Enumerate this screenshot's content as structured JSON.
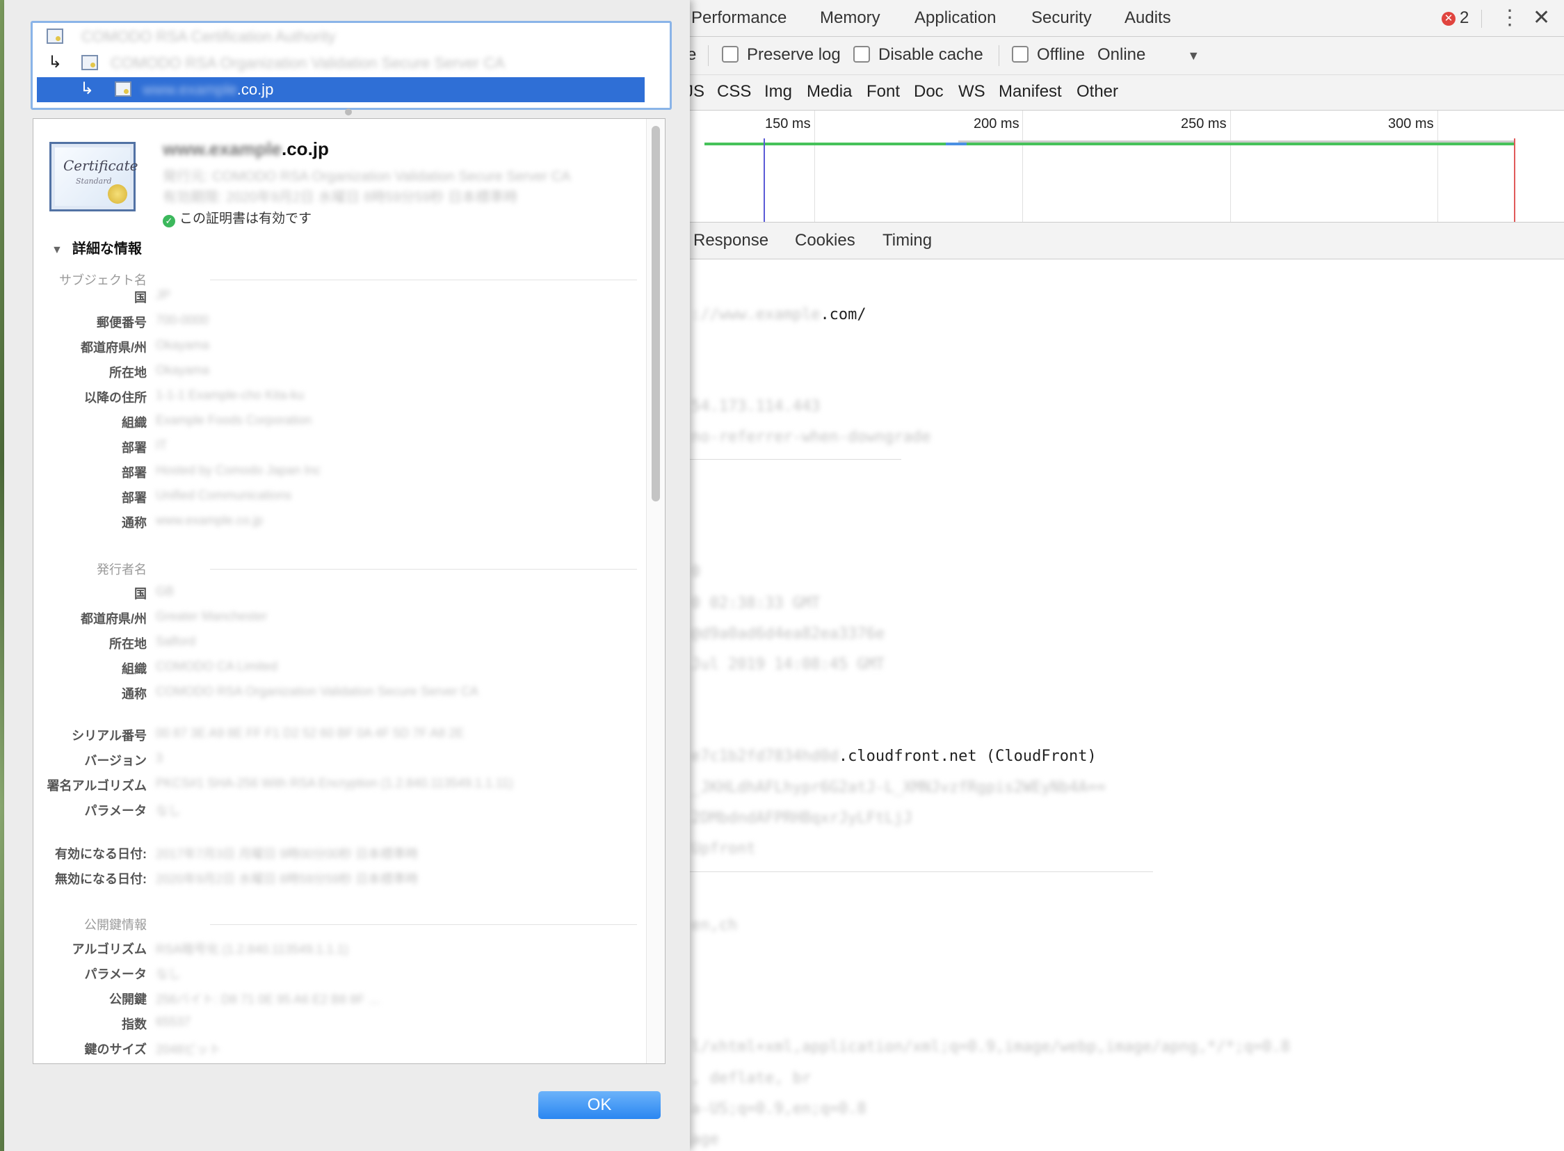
{
  "devtools": {
    "tabs": [
      "Performance",
      "Memory",
      "Application",
      "Security",
      "Audits"
    ],
    "error_count": "2",
    "more_icon": "⋮",
    "close_icon": "✕",
    "toolbar": {
      "partial_label": "e",
      "preserve_log": "Preserve log",
      "disable_cache": "Disable cache",
      "offline": "Offline",
      "throttle_value": "Online",
      "dropdown_icon": "▼"
    },
    "filters": [
      "JS",
      "CSS",
      "Img",
      "Media",
      "Font",
      "Doc",
      "WS",
      "Manifest",
      "Other"
    ],
    "timeline_ticks": [
      "150 ms",
      "200 ms",
      "250 ms",
      "300 ms"
    ],
    "detail_tabs": [
      "Response",
      "Cookies",
      "Timing"
    ],
    "lines": {
      "url_blur": "://www.example",
      "url_suffix": ".com/",
      "addr": "54.173.114.443",
      "policy": "no-referrer-when-downgrade",
      "l1": "0",
      "l2": "0  02:38:33 GMT",
      "l3": "@d9a0ad6d4ea82ea3376e",
      "l4": "Jul 2019 14:08:45 GMT",
      "via_blur": "e7c1b2fd7834hd0d",
      "via_suffix": ".cloudfront.net (CloudFront)",
      "v1": "_JKHLdhAFLhypr6G2atJ-L_XMNJvzfRgpis2WEyNb4A==",
      "v2": "2DMbdndAFPRHBqxrJyLFtLjJ",
      "v3": "Upfront",
      "e1": "en,ch",
      "a1": "l/xhtml+xml,application/xml;q=0.9,image/webp,image/apng,*/*;q=0.8",
      "a2": ", deflate, br",
      "a3": "a-US;q=0.9,en;q=0.8",
      "a4": "age"
    }
  },
  "chain": {
    "root": "COMODO RSA Certification Authority",
    "intermediate": "COMODO RSA Organization Validation Secure Server CA",
    "leaf_blur": "www.example",
    "leaf_suffix": ".co.jp",
    "arrow": "↳"
  },
  "cert": {
    "icon_title": "Certificate",
    "icon_sub": "Standard",
    "name_blur": "www.example",
    "name_suffix": ".co.jp",
    "issuer_line1": "発行元: COMODO RSA Organization Validation Secure Server CA",
    "issuer_line2": "有効期限: 2020年9月2日 水曜日 8時59分59秒 日本標準時",
    "valid_text": "この証明書は有効です",
    "details_label": "詳細な情報"
  },
  "subject": {
    "title": "サブジェクト名",
    "fields": [
      {
        "label": "国",
        "value": "JP"
      },
      {
        "label": "郵便番号",
        "value": "700-0000"
      },
      {
        "label": "都道府県/州",
        "value": "Okayama"
      },
      {
        "label": "所在地",
        "value": "Okayama"
      },
      {
        "label": "以降の住所",
        "value": "1-1-1 Example-cho Kita-ku"
      },
      {
        "label": "組織",
        "value": "Example Foods Corporation"
      },
      {
        "label": "部署",
        "value": "IT"
      },
      {
        "label": "部署",
        "value": "Hosted by Comodo Japan Inc"
      },
      {
        "label": "部署",
        "value": "Unified Communications"
      },
      {
        "label": "通称",
        "value": "www.example.co.jp"
      }
    ]
  },
  "issuer": {
    "title": "発行者名",
    "fields": [
      {
        "label": "国",
        "value": "GB"
      },
      {
        "label": "都道府県/州",
        "value": "Greater Manchester"
      },
      {
        "label": "所在地",
        "value": "Salford"
      },
      {
        "label": "組織",
        "value": "COMODO CA Limited"
      },
      {
        "label": "通称",
        "value": "COMODO RSA Organization Validation Secure Server CA"
      }
    ]
  },
  "misc": {
    "fields": [
      {
        "label": "シリアル番号",
        "value": "00 87 3E A9 8E FF F1 D2 52 60 BF 0A 4F 5D 7F A8 2E"
      },
      {
        "label": "バージョン",
        "value": "3"
      },
      {
        "label": "署名アルゴリズム",
        "value": "PKCS#1 SHA-256 With RSA Encryption (1.2.840.113549.1.1.11)"
      },
      {
        "label": "パラメータ",
        "value": "なし"
      }
    ]
  },
  "validity": {
    "fields": [
      {
        "label": "有効になる日付:",
        "value": "2017年7月3日 月曜日 9時00分00秒 日本標準時"
      },
      {
        "label": "無効になる日付:",
        "value": "2020年9月2日 水曜日 8時59分59秒 日本標準時"
      }
    ]
  },
  "pubkey": {
    "title": "公開鍵情報",
    "fields": [
      {
        "label": "アルゴリズム",
        "value": "RSA暗号化 (1.2.840.113549.1.1.1)"
      },
      {
        "label": "パラメータ",
        "value": "なし"
      },
      {
        "label": "公開鍵",
        "value": "256バイト: D8 71 0E 95 A6 E2 B8 8F …"
      },
      {
        "label": "指数",
        "value": "65537"
      },
      {
        "label": "鍵のサイズ",
        "value": "2048ビット"
      }
    ]
  },
  "ok_label": "OK"
}
